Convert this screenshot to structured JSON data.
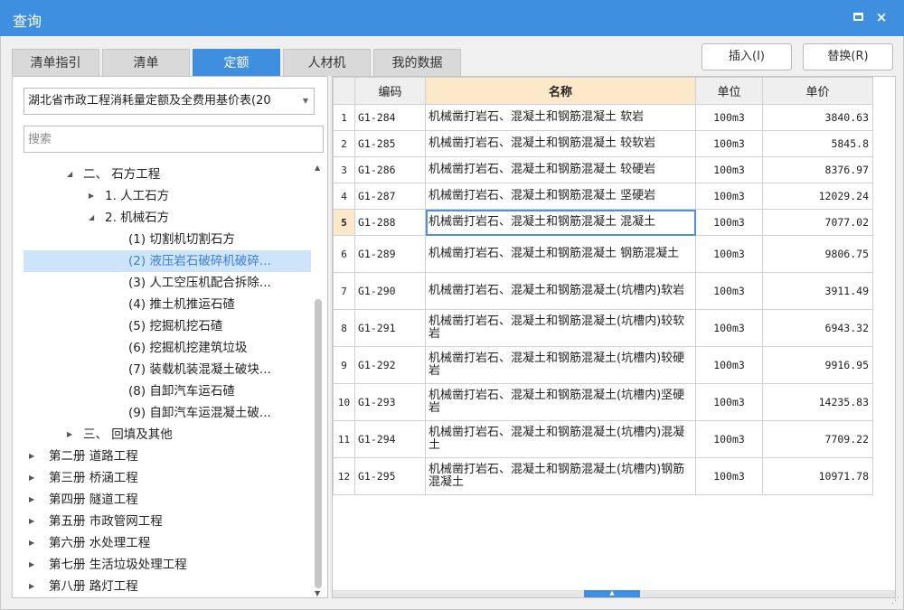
{
  "window": {
    "title": "查询",
    "max_icon": "maximize-icon",
    "close_icon": "close-icon",
    "close_glyph": "×"
  },
  "tabs": [
    {
      "label": "清单指引",
      "active": false
    },
    {
      "label": "清单",
      "active": false
    },
    {
      "label": "定额",
      "active": true
    },
    {
      "label": "人材机",
      "active": false
    },
    {
      "label": "我的数据",
      "active": false
    }
  ],
  "buttons": {
    "insert": "插入(I)",
    "replace": "替换(R)"
  },
  "library": {
    "selected": "湖北省市政工程消耗量定额及全费用基价表(20"
  },
  "search": {
    "placeholder": "搜索",
    "value": ""
  },
  "tree": [
    {
      "label": "二、 石方工程",
      "toggle": "◢"
    },
    {
      "label": "1. 人工石方",
      "toggle": "▶"
    },
    {
      "label": "2. 机械石方",
      "toggle": "◢"
    },
    {
      "label": "(1) 切割机切割石方",
      "toggle": ""
    },
    {
      "label": "(2) 液压岩石破碎机破碎...",
      "toggle": "",
      "selected": true
    },
    {
      "label": "(3) 人工空压机配合拆除...",
      "toggle": ""
    },
    {
      "label": "(4) 推土机推运石碴",
      "toggle": ""
    },
    {
      "label": "(5) 挖掘机挖石碴",
      "toggle": ""
    },
    {
      "label": "(6) 挖掘机挖建筑垃圾",
      "toggle": ""
    },
    {
      "label": "(7) 装载机装混凝土破块...",
      "toggle": ""
    },
    {
      "label": "(8) 自卸汽车运石碴",
      "toggle": ""
    },
    {
      "label": "(9) 自卸汽车运混凝土破...",
      "toggle": ""
    },
    {
      "label": "三、 回填及其他",
      "toggle": "▶"
    },
    {
      "label": "第二册 道路工程",
      "toggle": "▶"
    },
    {
      "label": "第三册 桥涵工程",
      "toggle": "▶"
    },
    {
      "label": "第四册 隧道工程",
      "toggle": "▶"
    },
    {
      "label": "第五册 市政管网工程",
      "toggle": "▶"
    },
    {
      "label": "第六册 水处理工程",
      "toggle": "▶"
    },
    {
      "label": "第七册 生活垃圾处理工程",
      "toggle": "▶"
    },
    {
      "label": "第八册 路灯工程",
      "toggle": "▶"
    }
  ],
  "table": {
    "headers": [
      "",
      "编码",
      "名称",
      "单位",
      "单价"
    ],
    "rows": [
      {
        "no": "1",
        "code": "G1-284",
        "name": "机械凿打岩石、混凝土和钢筋混凝土 软岩",
        "unit": "100m3",
        "price": "3840.63"
      },
      {
        "no": "2",
        "code": "G1-285",
        "name": "机械凿打岩石、混凝土和钢筋混凝土 较软岩",
        "unit": "100m3",
        "price": "5845.8"
      },
      {
        "no": "3",
        "code": "G1-286",
        "name": "机械凿打岩石、混凝土和钢筋混凝土 较硬岩",
        "unit": "100m3",
        "price": "8376.97"
      },
      {
        "no": "4",
        "code": "G1-287",
        "name": "机械凿打岩石、混凝土和钢筋混凝土 坚硬岩",
        "unit": "100m3",
        "price": "12029.24"
      },
      {
        "no": "5",
        "code": "G1-288",
        "name": "机械凿打岩石、混凝土和钢筋混凝土 混凝土",
        "unit": "100m3",
        "price": "7077.02",
        "current": true
      },
      {
        "no": "6",
        "code": "G1-289",
        "name": "机械凿打岩石、混凝土和钢筋混凝土 钢筋混凝土",
        "unit": "100m3",
        "price": "9806.75"
      },
      {
        "no": "7",
        "code": "G1-290",
        "name": "机械凿打岩石、混凝土和钢筋混凝土(坑槽内)软岩",
        "unit": "100m3",
        "price": "3911.49"
      },
      {
        "no": "8",
        "code": "G1-291",
        "name": "机械凿打岩石、混凝土和钢筋混凝土(坑槽内)较软岩",
        "unit": "100m3",
        "price": "6943.32"
      },
      {
        "no": "9",
        "code": "G1-292",
        "name": "机械凿打岩石、混凝土和钢筋混凝土(坑槽内)较硬岩",
        "unit": "100m3",
        "price": "9916.95"
      },
      {
        "no": "10",
        "code": "G1-293",
        "name": "机械凿打岩石、混凝土和钢筋混凝土(坑槽内)坚硬岩",
        "unit": "100m3",
        "price": "14235.83"
      },
      {
        "no": "11",
        "code": "G1-294",
        "name": "机械凿打岩石、混凝土和钢筋混凝土(坑槽内)混凝土",
        "unit": "100m3",
        "price": "7709.22"
      },
      {
        "no": "12",
        "code": "G1-295",
        "name": "机械凿打岩石、混凝土和钢筋混凝土(坑槽内)钢筋混凝土",
        "unit": "100m3",
        "price": "10971.78"
      }
    ]
  }
}
